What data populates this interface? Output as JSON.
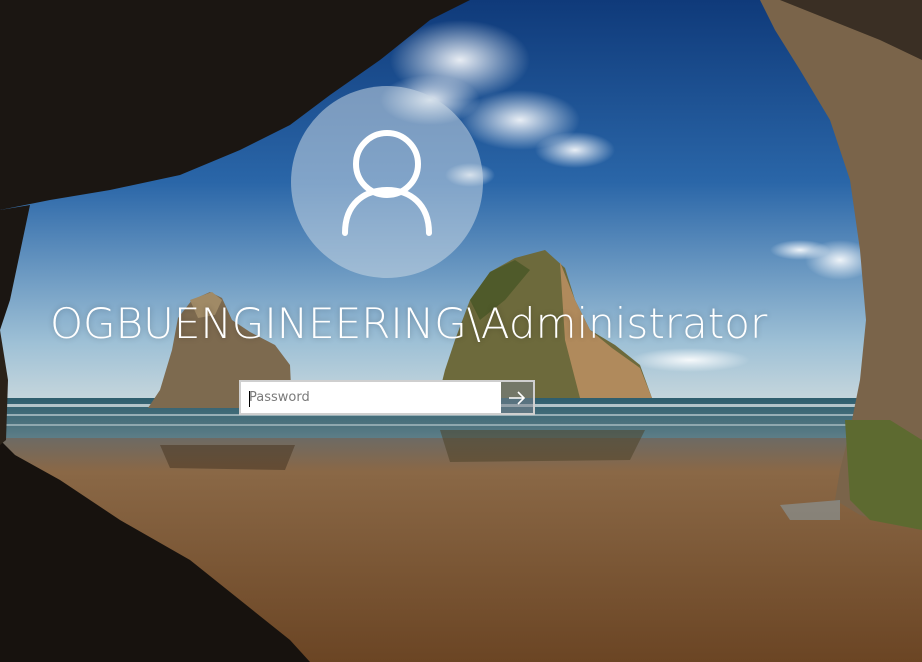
{
  "login": {
    "username": "OGBUENGINEERING\\Administrator",
    "password_placeholder": "Password",
    "password_value": "",
    "submit_icon": "arrow-right-icon",
    "avatar_icon": "user-silhouette-icon"
  },
  "background": {
    "description_icon": "beach-cave-wallpaper",
    "sky_color": "#2a5f9e",
    "sand_color": "#8a6540",
    "rock_color": "#1c1712"
  }
}
